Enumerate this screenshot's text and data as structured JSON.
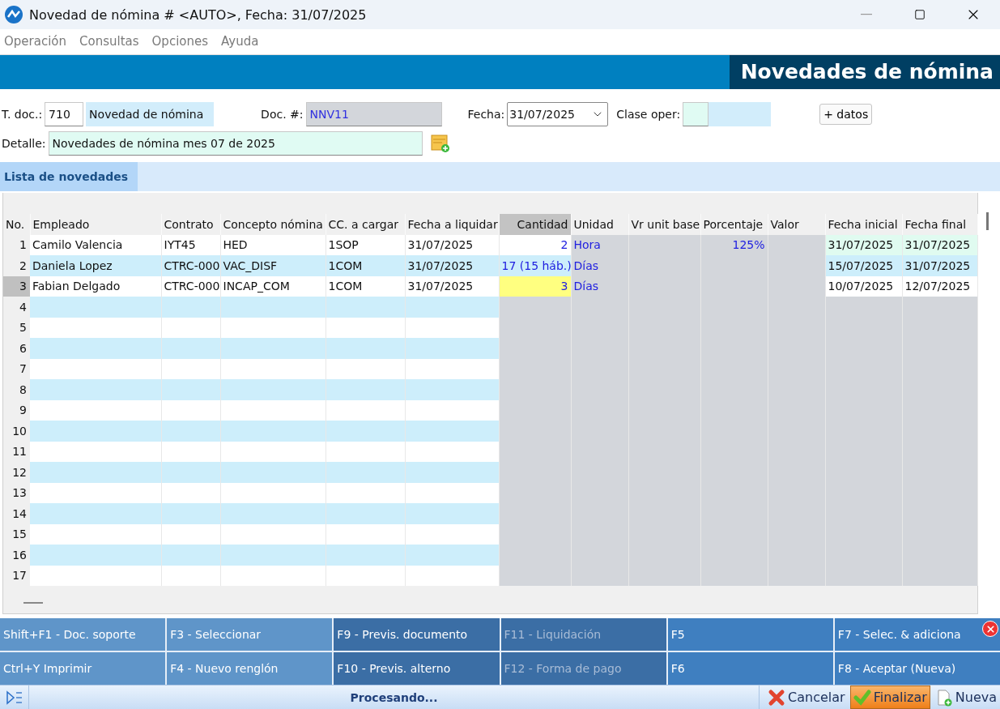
{
  "window": {
    "title": "Novedad de nómina # <AUTO>, Fecha: 31/07/2025"
  },
  "menu": [
    "Operación",
    "Consultas",
    "Opciones",
    "Ayuda"
  ],
  "banner": {
    "title": "Novedades de nómina"
  },
  "form": {
    "tdoc_label": "T. doc.:",
    "tdoc_value": "710",
    "tdoc_name": "Novedad de nómina",
    "doc_label": "Doc. #:",
    "doc_value": "NNV11",
    "fecha_label": "Fecha:",
    "fecha_value": "31/07/2025",
    "clase_label": "Clase oper:",
    "more_button": "+ datos",
    "detalle_label": "Detalle:",
    "detalle_value": "Novedades de nómina mes 07 de 2025"
  },
  "tabs": [
    {
      "label": "Lista de novedades",
      "selected": true
    }
  ],
  "table": {
    "columns": [
      "No.",
      "Empleado",
      "Contrato",
      "Concepto nómina",
      "CC. a cargar",
      "Fecha a liquidar",
      "Cantidad",
      "Unidad",
      "Vr unit base",
      "Porcentaje",
      "Valor",
      "Fecha inicial",
      "Fecha final"
    ],
    "rows": [
      {
        "no": "1",
        "selected": false,
        "cells": [
          "Camilo Valencia",
          "IYT45",
          "HED",
          "1SOP",
          "31/07/2025",
          "2",
          "Hora",
          "",
          "125%",
          "",
          "31/07/2025",
          "31/07/2025"
        ]
      },
      {
        "no": "2",
        "selected": false,
        "cells": [
          "Daniela Lopez",
          "CTRC-000",
          "VAC_DISF",
          "1COM",
          "31/07/2025",
          "17 (15 háb.)",
          "Días",
          "",
          "",
          "",
          "15/07/2025",
          "31/07/2025"
        ]
      },
      {
        "no": "3",
        "selected": true,
        "cells": [
          "Fabian Delgado",
          "CTRC-000",
          "INCAP_COM",
          "1COM",
          "31/07/2025",
          "3",
          "Días",
          "",
          "",
          "",
          "10/07/2025",
          "12/07/2025"
        ]
      },
      {
        "no": "4",
        "selected": false
      },
      {
        "no": "5",
        "selected": false
      },
      {
        "no": "6",
        "selected": false
      },
      {
        "no": "7",
        "selected": false
      },
      {
        "no": "8",
        "selected": false
      },
      {
        "no": "9",
        "selected": false
      },
      {
        "no": "10",
        "selected": false
      },
      {
        "no": "11",
        "selected": false
      },
      {
        "no": "12",
        "selected": false
      },
      {
        "no": "13",
        "selected": false
      },
      {
        "no": "14",
        "selected": false
      },
      {
        "no": "15",
        "selected": false
      },
      {
        "no": "16",
        "selected": false
      },
      {
        "no": "17",
        "selected": false
      }
    ]
  },
  "function_keys": [
    {
      "label": "Shift+F1 - Doc. soporte",
      "disabled": false
    },
    {
      "label": "F3 - Seleccionar",
      "disabled": false
    },
    {
      "label": "F9 - Previs. documento",
      "disabled": false
    },
    {
      "label": "F11 - Liquidación",
      "disabled": true
    },
    {
      "label": "F5",
      "disabled": false
    },
    {
      "label": "F7 - Selec. & adiciona",
      "disabled": false
    },
    {
      "label": "Ctrl+Y Imprimir",
      "disabled": false
    },
    {
      "label": "F4 - Nuevo renglón",
      "disabled": false
    },
    {
      "label": "F10 - Previs. alterno",
      "disabled": false
    },
    {
      "label": "F12 - Forma de pago",
      "disabled": true
    },
    {
      "label": "F6",
      "disabled": false
    },
    {
      "label": "F8 - Aceptar (Nueva)",
      "disabled": false
    }
  ],
  "status_bar": {
    "message": "Procesando...",
    "buttons": [
      {
        "kind": "cancel",
        "label": "Cancelar",
        "selected": false
      },
      {
        "kind": "finish",
        "label": "Finalizar",
        "selected": true
      },
      {
        "kind": "new",
        "label": "Nueva",
        "selected": false
      }
    ]
  }
}
